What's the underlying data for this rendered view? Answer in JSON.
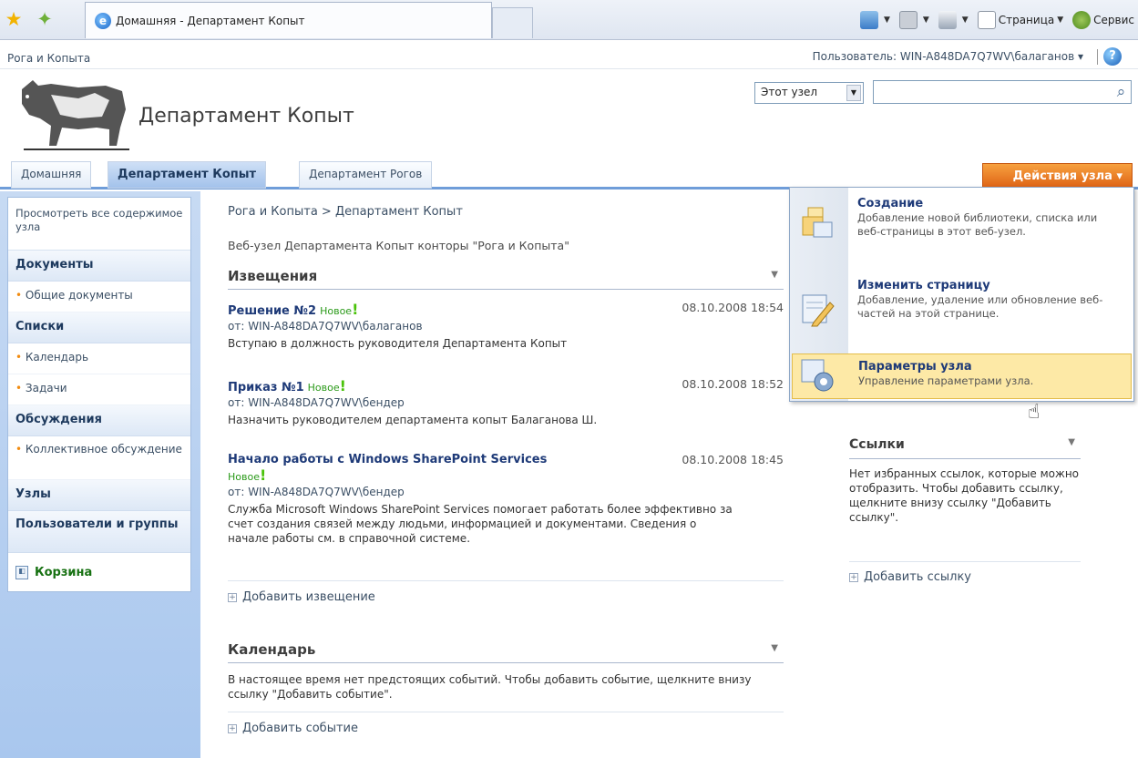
{
  "browser": {
    "tab_title": "Домашняя - Департамент Копыт",
    "tools": {
      "page_label": "Страница",
      "service_label": "Сервис"
    }
  },
  "topline": {
    "site_crumb": "Рога и Копыта",
    "user_label": "Пользователь: WIN-A848DA7Q7WV\\балаганов ▾"
  },
  "header": {
    "site_title": "Департамент Копыт",
    "search_scope": "Этот узел"
  },
  "topnav": {
    "tabs": [
      "Домашняя",
      "Департамент Копыт",
      "Департамент Рогов"
    ],
    "site_actions": "Действия узла ▾"
  },
  "leftnav": {
    "view_all": "Просмотреть все содержимое узла",
    "documents": "Документы",
    "shared_docs": "Общие документы",
    "lists": "Списки",
    "calendar": "Календарь",
    "tasks": "Задачи",
    "discussions": "Обсуждения",
    "team_discussion": "Коллективное обсуждение",
    "sites": "Узлы",
    "people": "Пользователи и группы",
    "recycle": "Корзина"
  },
  "main": {
    "breadcrumb": "Рога и Копыта > Департамент Копыт",
    "site_description": "Веб-узел Департамента Копыт конторы \"Рога и Копыта\"",
    "announcements_title": "Извещения",
    "new_label": "Новое",
    "announcements": [
      {
        "title": "Решение №2",
        "date": "08.10.2008 18:54",
        "from": "от: WIN-A848DA7Q7WV\\балаганов",
        "body": "Вступаю в должность руководителя Департамента Копыт"
      },
      {
        "title": "Приказ №1",
        "date": "08.10.2008 18:52",
        "from": "от: WIN-A848DA7Q7WV\\бендер",
        "body": "Назначить руководителем департамента копыт Балаганова Ш."
      },
      {
        "title": "Начало работы с Windows SharePoint Services",
        "date": "08.10.2008 18:45",
        "from": "от: WIN-A848DA7Q7WV\\бендер",
        "body": "Служба Microsoft Windows SharePoint Services помогает работать более эффективно за счет создания связей между людьми, информацией и документами. Сведения о начале работы см. в справочной системе."
      }
    ],
    "add_announcement": "Добавить извещение",
    "calendar_title": "Календарь",
    "calendar_empty": "В настоящее время нет предстоящих событий. Чтобы добавить событие, щелкните внизу ссылку \"Добавить событие\".",
    "add_event": "Добавить событие"
  },
  "links": {
    "title": "Ссылки",
    "empty": "Нет избранных ссылок, которые можно отобразить. Чтобы добавить ссылку, щелкните внизу ссылку \"Добавить ссылку\".",
    "add": "Добавить ссылку"
  },
  "site_actions_menu": [
    {
      "title": "Создание",
      "desc": "Добавление новой библиотеки, списка или веб-страницы в этот веб-узел."
    },
    {
      "title": "Изменить страницу",
      "desc": "Добавление, удаление или обновление веб-частей на этой странице."
    },
    {
      "title": "Параметры узла",
      "desc": "Управление параметрами узла."
    }
  ]
}
